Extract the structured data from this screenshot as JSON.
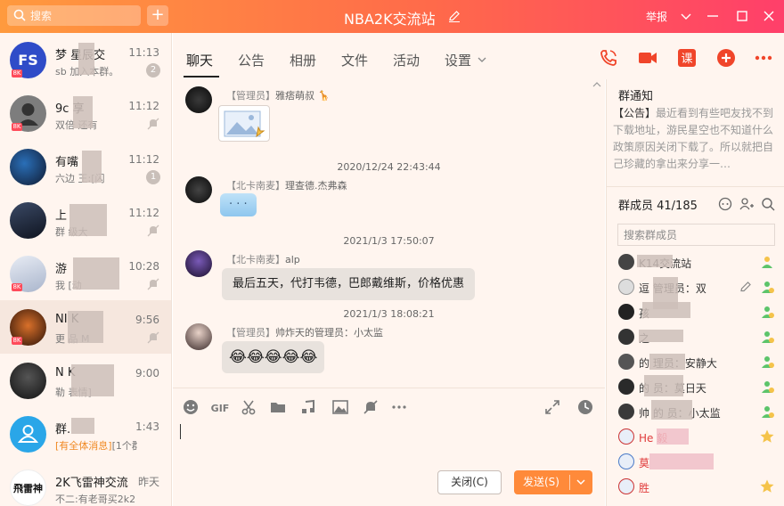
{
  "window": {
    "title": "NBA2K交流站",
    "search_placeholder": "搜索",
    "report_label": "举报",
    "add_label": "+"
  },
  "sessions": [
    {
      "name": "梦 星辰交",
      "time": "11:13",
      "preview": "sb 加入本群。",
      "count": "2",
      "avatar_text": "FS",
      "avatar_color": "#2f4cc8",
      "badge": "8K"
    },
    {
      "name": "9c 享",
      "time": "11:12",
      "preview": "双倍 还有",
      "muted": true,
      "badge": "8K"
    },
    {
      "name": "有嘴 ",
      "time": "11:12",
      "preview": "六边 王:[闪",
      "count": "1"
    },
    {
      "name": "上 ",
      "time": "11:12",
      "preview": "群 级大",
      "muted": true
    },
    {
      "name": "游 ",
      "time": "10:28",
      "preview": "我 [动",
      "muted": true,
      "badge": "8K"
    },
    {
      "name": "NI K ",
      "time": "9:56",
      "preview": "更 品 M",
      "muted": true,
      "badge": "8K"
    },
    {
      "name": "N K ",
      "time": "9:00",
      "preview": "勒 表情]",
      "muted": true
    },
    {
      "name": "群.",
      "time": "1:43",
      "preview_highlight": "[有全体消息]",
      "preview": "[1个群",
      "muted": true
    },
    {
      "name": "2K飞雷神交流",
      "time": "昨天",
      "preview": "不二:有老哥买2k2"
    }
  ],
  "tabs": [
    "聊天",
    "公告",
    "相册",
    "文件",
    "活动",
    "设置"
  ],
  "messages": [
    {
      "sender_role": "【管理员】",
      "sender_name": "雅痞萌叔",
      "type": "image"
    },
    {
      "timestamp": "2020/12/24 22:43:44"
    },
    {
      "sender_role": "【北卡南麦】",
      "sender_name": "理查德.杰弗森",
      "type": "sticker",
      "text": "· · ·"
    },
    {
      "timestamp": "2021/1/3 17:50:07"
    },
    {
      "sender_role": "【北卡南麦】",
      "sender_name": "alp",
      "type": "text",
      "text": "最后五天，代打韦德，巴郎戴维斯，价格优惠"
    },
    {
      "timestamp": "2021/1/3 18:08:21"
    },
    {
      "sender_role": "【管理员】",
      "sender_name": "帅炸天的管理员：小太监",
      "type": "emoji",
      "text": "😂😂😂😂😂"
    }
  ],
  "input": {
    "close_label": "关闭(C)",
    "send_label": "发送(S)"
  },
  "notice": {
    "title": "群通知",
    "tag": "【公告】",
    "body": "最近看到有些吧友找不到下载地址，游民星空也不知道什么政策原因关闭下载了。所以就把自己珍藏的拿出来分享一…"
  },
  "members": {
    "title": "群成员 41/185",
    "search_placeholder": "搜索群成员",
    "list": [
      {
        "name": "K14交流站",
        "role": "owner",
        "red": false
      },
      {
        "name": "逗 管理员：双",
        "role": "admin",
        "red": false
      },
      {
        "name": "孩 ",
        "role": "admin",
        "red": false
      },
      {
        "name": "之",
        "role": "admin",
        "red": false
      },
      {
        "name": "的 理员：安静大",
        "role": "admin",
        "red": false
      },
      {
        "name": "的 员：莫日天",
        "role": "admin",
        "red": false
      },
      {
        "name": "帅 的 员：小太监",
        "role": "admin",
        "red": false
      },
      {
        "name": "He 毅",
        "role": "star",
        "red": true
      },
      {
        "name": "莫 ",
        "role": "",
        "red": true
      },
      {
        "name": "胜",
        "role": "star",
        "red": true
      }
    ]
  },
  "colors": {
    "accent": "#ff8a3a",
    "title_gradient_start": "#ff9a3e",
    "title_gradient_end": "#ff3f6a",
    "icon_red": "#f0452a"
  }
}
